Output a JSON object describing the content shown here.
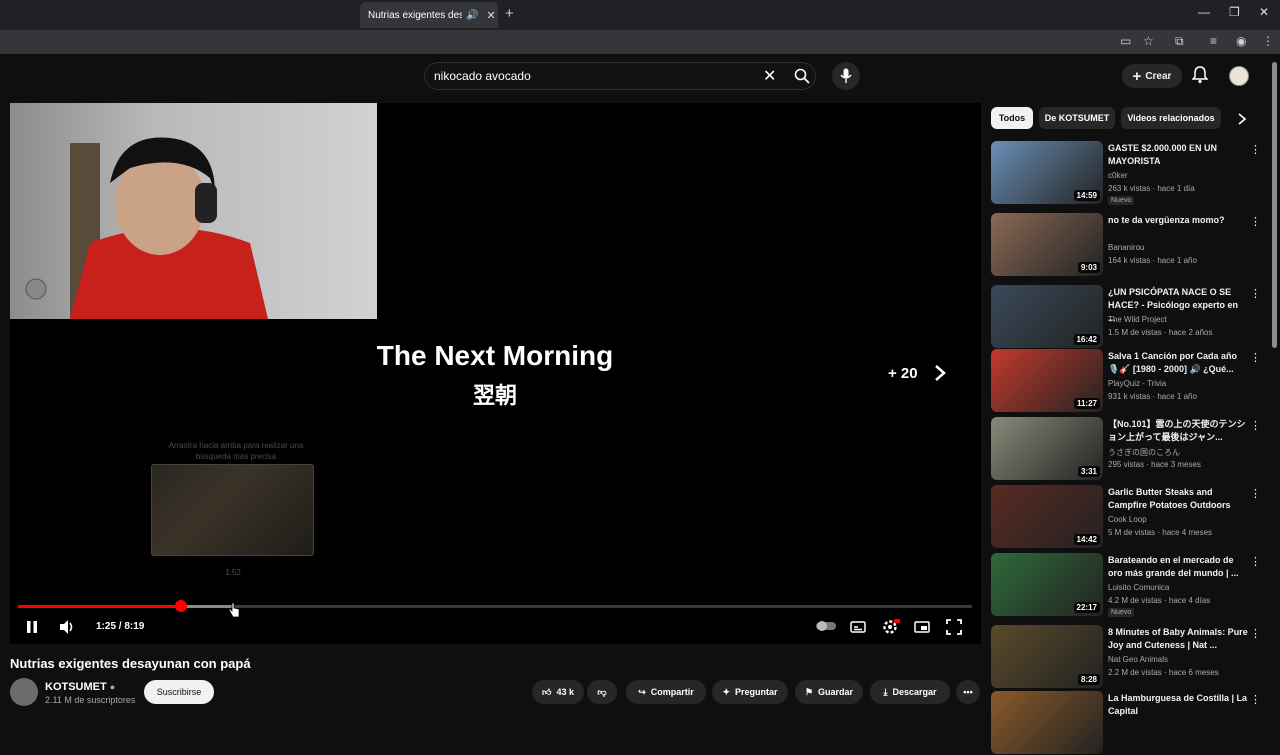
{
  "browser": {
    "tab_title": "Nutrias exigentes desayuna",
    "tab_close": "✕",
    "new_tab": "+"
  },
  "masthead": {
    "search_value": "nikocado avocado",
    "create_label": "Crear"
  },
  "player": {
    "overlay_title": "The Next Morning",
    "overlay_subtitle": "翌朝",
    "skip_label": "+ 20",
    "seek_hint": "Arrastra hacia arriba para realizar una búsqueda más precisa",
    "preview_time": "1:52",
    "time_display": "1:25 / 8:19",
    "progress_fraction": 0.171,
    "buffer_fraction": 0.225
  },
  "video": {
    "title": "Nutrias exigentes desayunan con papá",
    "channel_name": "KOTSUMET",
    "subscribers": "2.11 M de suscriptores",
    "subscribe_label": "Suscribirse",
    "like_count": "43 k",
    "share_label": "Compartir",
    "ask_label": "Preguntar",
    "save_label": "Guardar",
    "download_label": "Descargar"
  },
  "sidebar": {
    "chips": [
      "Todos",
      "De KOTSUMET",
      "Videos relacionados"
    ],
    "recommendations": [
      {
        "title": "GASTE $2.000.000 EN UN MAYORISTA",
        "channel": "c0ker",
        "meta": "263 k vistas · hace 1 día",
        "duration": "14:59",
        "badge": "Nuevo"
      },
      {
        "title": "no te da vergüenza momo?",
        "channel": "Bananirou",
        "meta": "164 k vistas · hace 1 año",
        "duration": "9:03",
        "badge": ""
      },
      {
        "title": "¿UN PSICÓPATA NACE O SE HACE? - Psicólogo experto en ...",
        "channel": "The Wild Project",
        "meta": "1.5 M de vistas · hace 2 años",
        "duration": "16:42",
        "badge": ""
      },
      {
        "title": "Salva 1 Canción por Cada año 🎙️🎸 [1980 - 2000] 🔊 ¿Qué...",
        "channel": "PlayQuiz - Trivia",
        "meta": "931 k vistas · hace 1 año",
        "duration": "11:27",
        "badge": ""
      },
      {
        "title": "【No.101】雲の上の天使のテンション上がって最後はジャン...",
        "channel": "うさぎの国のころん",
        "meta": "295 vistas · hace 3 meses",
        "duration": "3:31",
        "badge": ""
      },
      {
        "title": "Garlic Butter Steaks and Campfire Potatoes Outdoors",
        "channel": "Cook Loop",
        "meta": "5 M de vistas · hace 4 meses",
        "duration": "14:42",
        "badge": ""
      },
      {
        "title": "Barateando en el mercado de oro más grande del mundo | ...",
        "channel": "Luisito Comunica",
        "meta": "4.2 M de vistas · hace 4 días",
        "duration": "22:17",
        "badge": "Nuevo"
      },
      {
        "title": "8 Minutes of Baby Animals: Pure Joy and Cuteness | Nat ...",
        "channel": "Nat Geo Animals",
        "meta": "2.2 M de vistas · hace 6 meses",
        "duration": "8:28",
        "badge": ""
      },
      {
        "title": "La Hamburguesa de Costilla | La Capital",
        "channel": "",
        "meta": "",
        "duration": "",
        "badge": ""
      }
    ]
  },
  "thumb_colors": [
    "#6b8fb8",
    "#8a6a55",
    "#3a4a5a",
    "#c23a2a",
    "#8a8a7a",
    "#5a2a22",
    "#2f6a3a",
    "#5a4a2a",
    "#8a5a2a"
  ]
}
